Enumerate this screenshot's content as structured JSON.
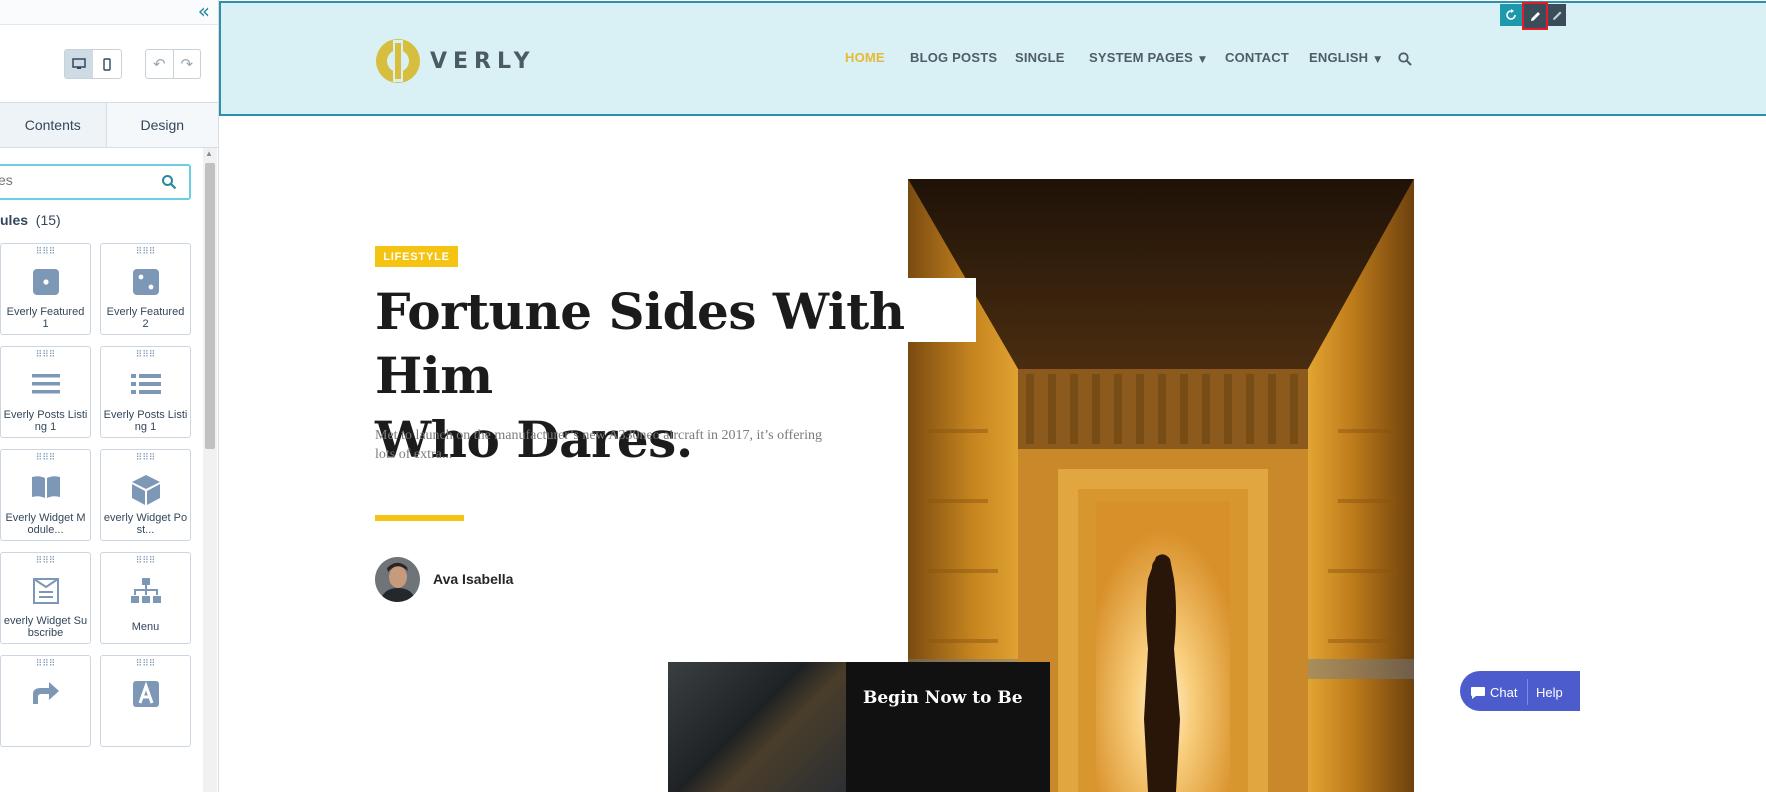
{
  "editor": {
    "collapse_icon": "«",
    "undo_icon": "↶",
    "redo_icon": "↷",
    "tabs": [
      "Contents",
      "Design"
    ],
    "search_placeholder": "es",
    "modules_label": "ules",
    "modules_count": "(15)",
    "modules": [
      {
        "label": "Everly Featured 1",
        "icon": "dice-one-icon"
      },
      {
        "label": "Everly Featured 2",
        "icon": "dice-two-icon"
      },
      {
        "label": "Everly Posts Listing 1",
        "icon": "list-lines-icon"
      },
      {
        "label": "Everly Posts Listing 1",
        "icon": "list-bullets-icon"
      },
      {
        "label": "Everly Widget Module...",
        "icon": "book-icon"
      },
      {
        "label": "everly Widget Post...",
        "icon": "cube-icon"
      },
      {
        "label": "everly Widget Subscribe",
        "icon": "newsletter-icon"
      },
      {
        "label": "Menu",
        "icon": "sitemap-icon"
      },
      {
        "label": "",
        "icon": "share-icon"
      },
      {
        "label": "",
        "icon": "text-a-icon"
      }
    ]
  },
  "site": {
    "logo_text": "VERLY",
    "nav": [
      {
        "label": "HOME",
        "active": true
      },
      {
        "label": "BLOG POSTS"
      },
      {
        "label": "SINGLE"
      },
      {
        "label": "SYSTEM PAGES",
        "dropdown": true
      },
      {
        "label": "CONTACT"
      },
      {
        "label": "ENGLISH",
        "dropdown": true
      }
    ],
    "accent_color": "#f5c311",
    "header_bg": "#d9f0f4"
  },
  "hero": {
    "badge": "LIFESTYLE",
    "title_line1": "Fortune Sides With Him",
    "title_line2": "Who Dares.",
    "excerpt": "Met to launch on the manufacturer’s new A330neo aircraft in 2017, it’s offering lots of extra...",
    "author": "Ava Isabella",
    "promo_text": "Begin Now to Be"
  },
  "chat": {
    "chat_label": "Chat",
    "help_label": "Help"
  }
}
